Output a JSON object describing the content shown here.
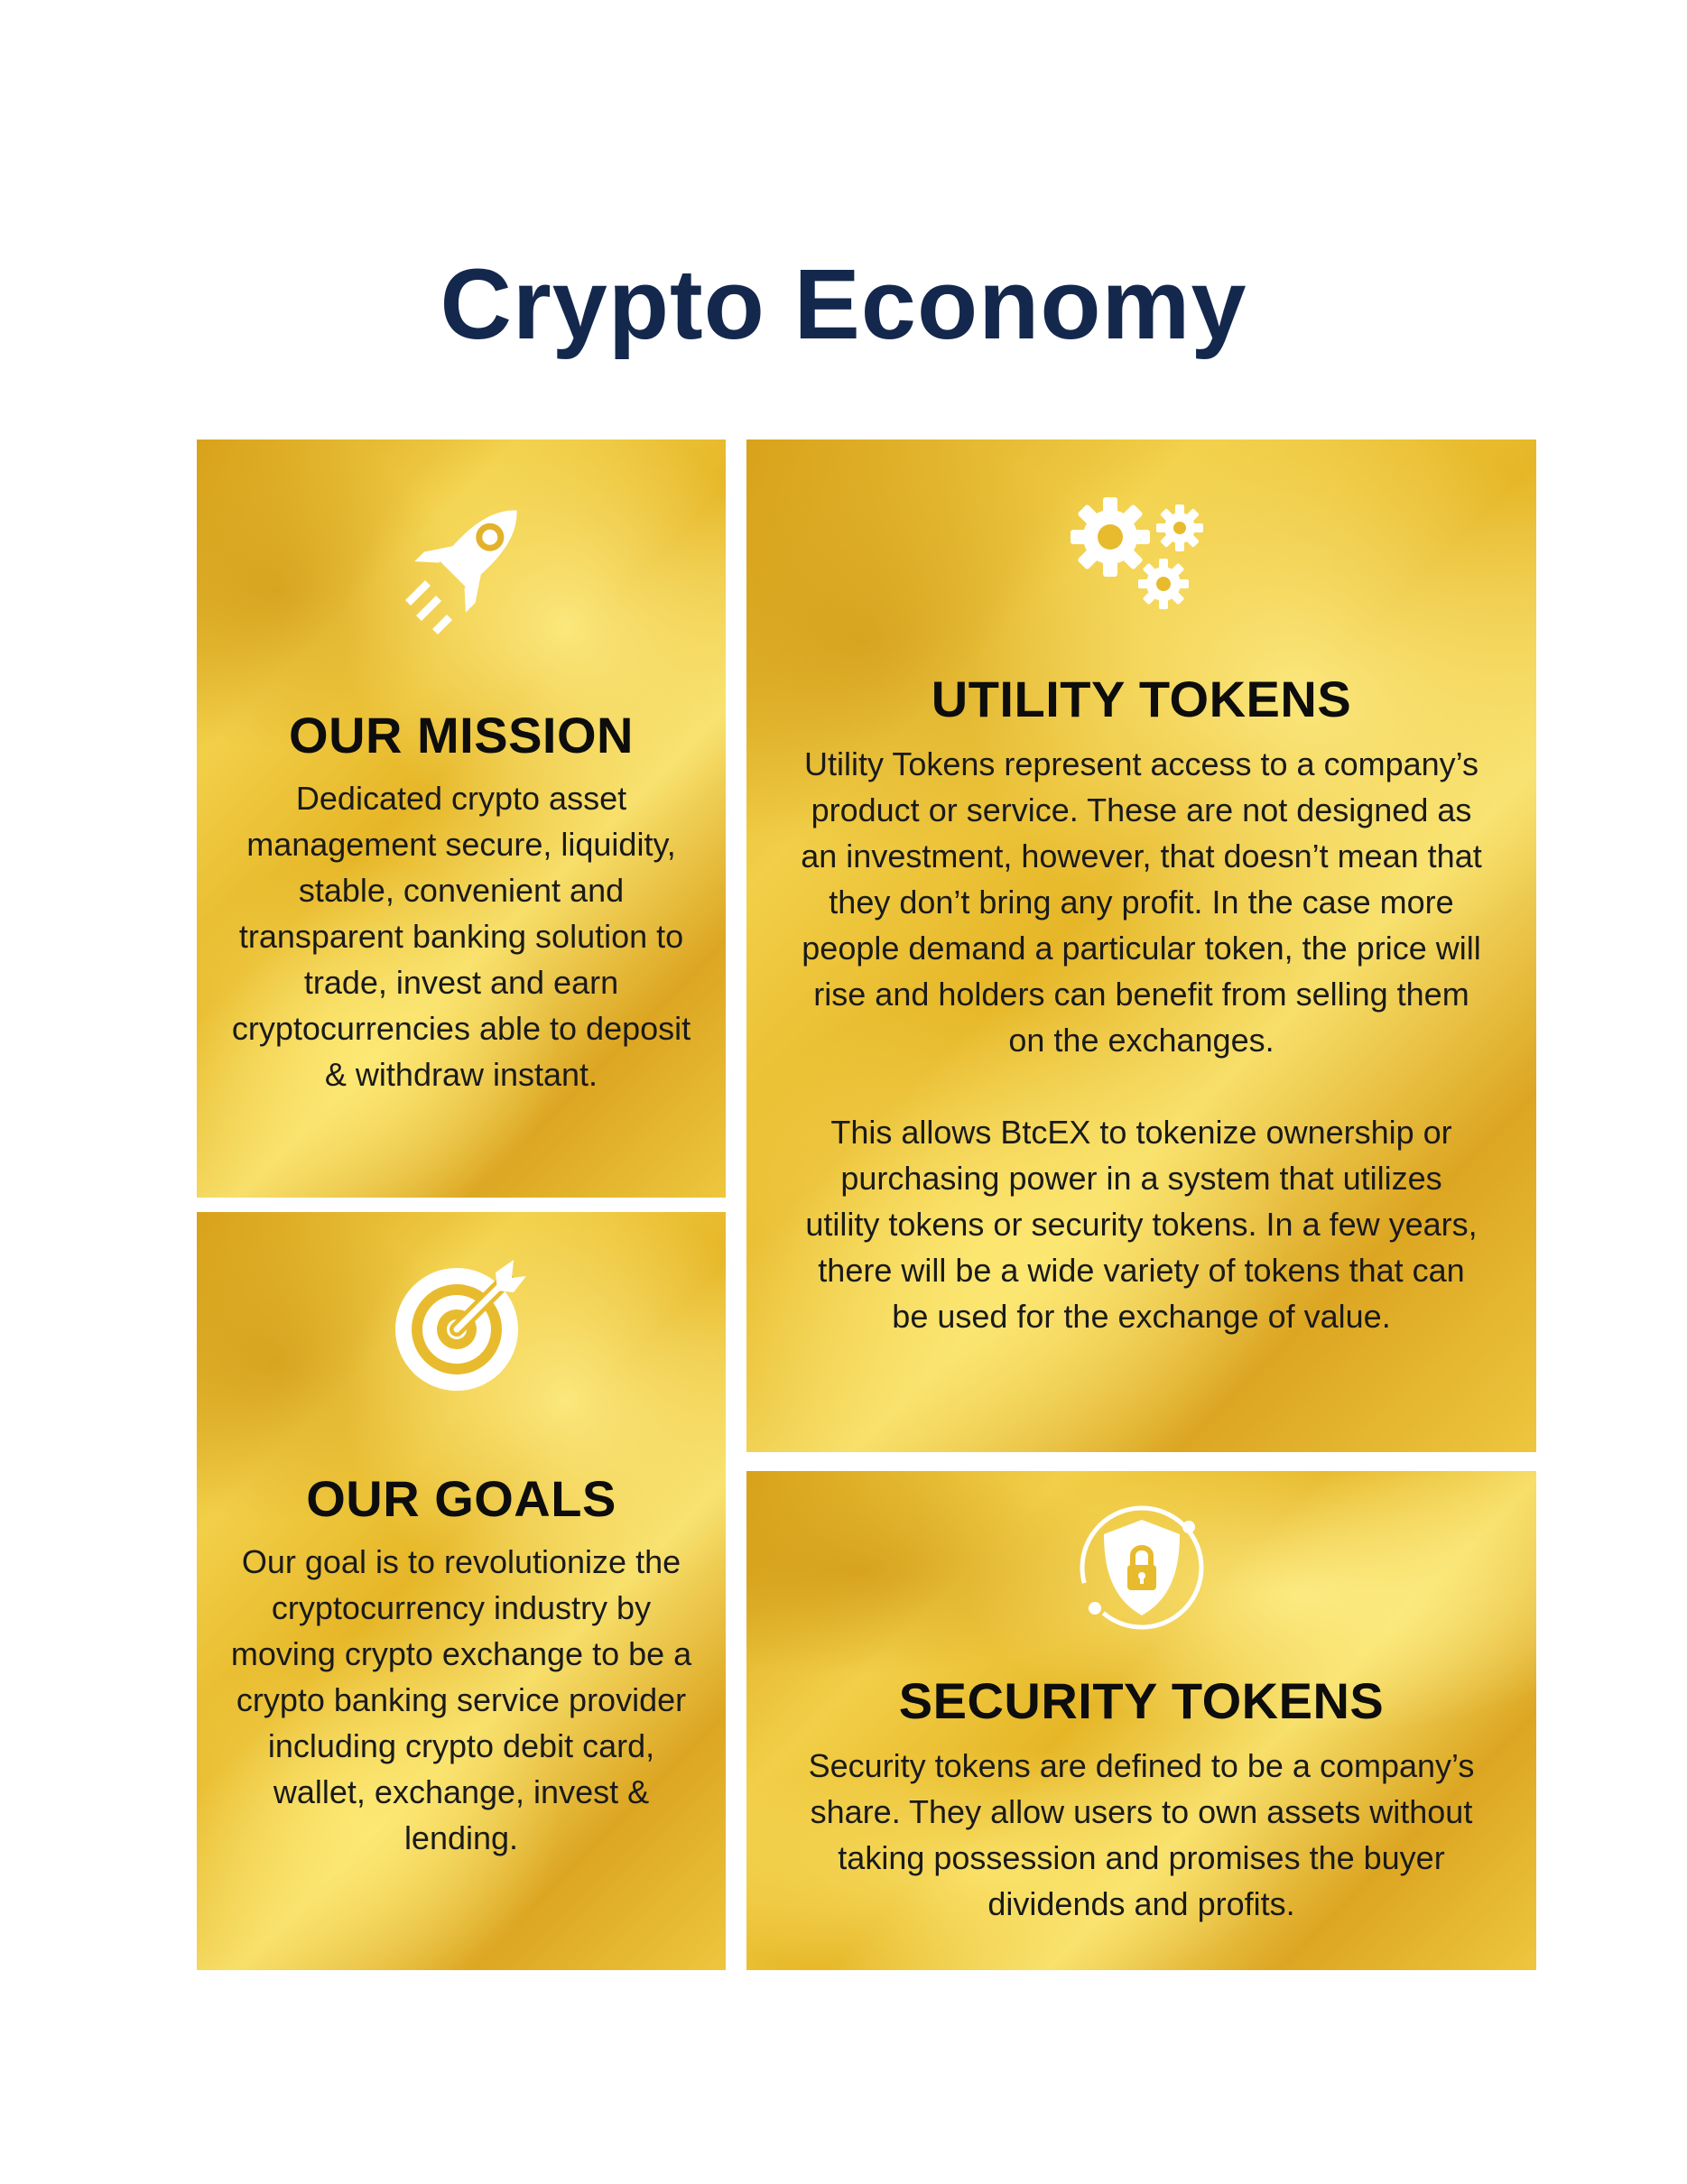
{
  "page": {
    "title": "Crypto Economy"
  },
  "colors": {
    "title": "#14284d",
    "card_gold": "#e8bb2e",
    "icon": "#ffffff",
    "text": "#141414"
  },
  "cards": {
    "mission": {
      "icon": "rocket-icon",
      "heading": "OUR MISSION",
      "body": "Dedicated crypto asset management secure, liquidity, stable, convenient and transparent banking solution to trade,  invest and earn cryptocurrencies able to deposit & withdraw instant."
    },
    "goals": {
      "icon": "target-icon",
      "heading": "OUR GOALS",
      "body": "Our goal is to revolutionize the cryptocurrency industry by moving crypto exchange to be a crypto banking service provider including crypto debit card, wallet, exchange, invest & lending."
    },
    "utility": {
      "icon": "gears-icon",
      "heading": "UTILITY TOKENS",
      "body_1": "Utility Tokens represent access to a company’s product or service. These are not designed as an investment, however, that doesn’t mean that they don’t bring any profit. In the case more people demand a particular token, the price will rise and holders can benefit from selling them on the exchanges.",
      "body_2": "This allows BtcEX to tokenize ownership or purchasing power in a system that utilizes utility tokens or security tokens. In a few years, there will be a wide variety of tokens that can be used for the exchange of value."
    },
    "security": {
      "icon": "shield-lock-icon",
      "heading": "SECURITY TOKENS",
      "body": "Security tokens are defined to be a company’s share. They allow users to own assets without taking possession and promises the buyer dividends and profits."
    }
  }
}
